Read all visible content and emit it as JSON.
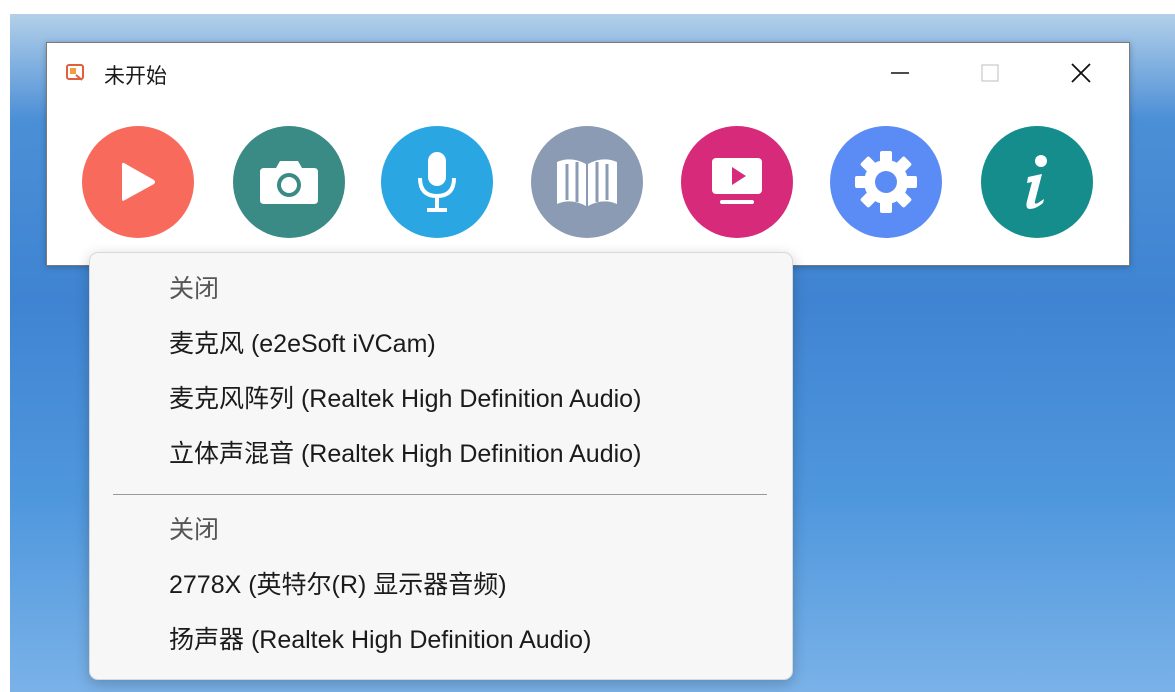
{
  "window": {
    "title": "未开始",
    "controls": {
      "minimize": "minimize",
      "maximize": "maximize",
      "close": "close"
    }
  },
  "toolbar": {
    "buttons": [
      {
        "id": "start",
        "icon": "play-icon",
        "color": "#f86b5c"
      },
      {
        "id": "screenshot",
        "icon": "camera-icon",
        "color": "#3a8a85"
      },
      {
        "id": "microphone",
        "icon": "microphone-icon",
        "color": "#2aa7e2"
      },
      {
        "id": "library",
        "icon": "book-icon",
        "color": "#8a9bb3"
      },
      {
        "id": "screen-record",
        "icon": "screen-play-icon",
        "color": "#d72a7a"
      },
      {
        "id": "settings",
        "icon": "gear-icon",
        "color": "#5b8cf5"
      },
      {
        "id": "about",
        "icon": "info-icon",
        "color": "#168d8d"
      }
    ]
  },
  "menu": {
    "group1": [
      "关闭",
      "麦克风 (e2eSoft iVCam)",
      "麦克风阵列 (Realtek High Definition Audio)",
      "立体声混音 (Realtek High Definition Audio)"
    ],
    "group2": [
      "关闭",
      "2778X (英特尔(R) 显示器音频)",
      "扬声器 (Realtek High Definition Audio)"
    ]
  }
}
